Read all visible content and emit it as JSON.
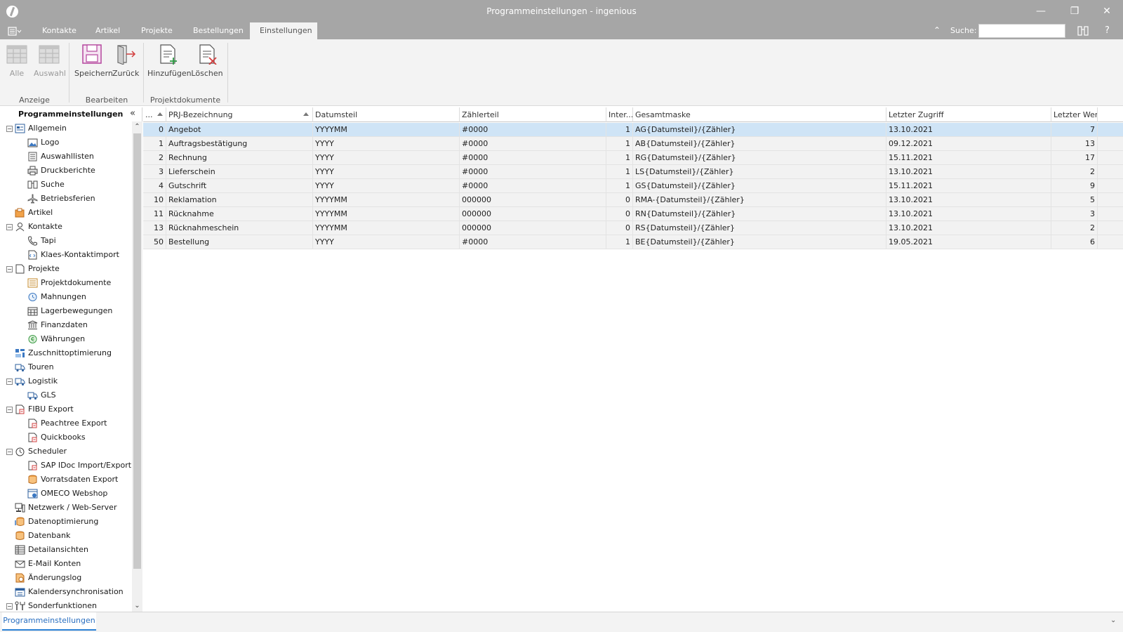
{
  "window": {
    "title": "Programmeinstellungen - ingenious",
    "minimize": "—",
    "maximize": "❐",
    "close": "✕"
  },
  "tabs": [
    {
      "label": "Kontakte"
    },
    {
      "label": "Artikel"
    },
    {
      "label": "Projekte"
    },
    {
      "label": "Bestellungen"
    },
    {
      "label": "Einstellungen",
      "active": true
    }
  ],
  "search": {
    "label": "Suche:",
    "value": "",
    "placeholder": ""
  },
  "help": "?",
  "ribbon": {
    "groups": [
      {
        "label": "Anzeige",
        "buttons": [
          {
            "label": "Alle"
          },
          {
            "label": "Auswahl"
          }
        ]
      },
      {
        "label": "Bearbeiten",
        "buttons": [
          {
            "label": "Speichern"
          },
          {
            "label": "Zurück"
          }
        ]
      },
      {
        "label": "Projektdokumente",
        "buttons": [
          {
            "label": "Hinzufügen"
          },
          {
            "label": "Löschen"
          }
        ]
      }
    ]
  },
  "sidebar": {
    "title": "Programmeinstellungen",
    "items": [
      {
        "label": "Allgemein",
        "level": 0,
        "expander": "−",
        "icon": "settings-window-icon"
      },
      {
        "label": "Logo",
        "level": 1,
        "icon": "image-icon"
      },
      {
        "label": "Auswahllisten",
        "level": 1,
        "icon": "list-icon"
      },
      {
        "label": "Druckberichte",
        "level": 1,
        "icon": "printer-icon"
      },
      {
        "label": "Suche",
        "level": 1,
        "icon": "binoculars-icon"
      },
      {
        "label": "Betriebsferien",
        "level": 1,
        "icon": "airplane-icon"
      },
      {
        "label": "Artikel",
        "level": 0,
        "icon": "box-icon"
      },
      {
        "label": "Kontakte",
        "level": 0,
        "expander": "−",
        "icon": "person-icon"
      },
      {
        "label": "Tapi",
        "level": 1,
        "icon": "phone-icon"
      },
      {
        "label": "Klaes-Kontaktimport",
        "level": 1,
        "icon": "xml-file-icon"
      },
      {
        "label": "Projekte",
        "level": 0,
        "expander": "−",
        "icon": "document-icon"
      },
      {
        "label": "Projektdokumente",
        "level": 1,
        "icon": "document-list-icon"
      },
      {
        "label": "Mahnungen",
        "level": 1,
        "icon": "reminder-icon"
      },
      {
        "label": "Lagerbewegungen",
        "level": 1,
        "icon": "warehouse-icon"
      },
      {
        "label": "Finanzdaten",
        "level": 1,
        "icon": "bank-icon"
      },
      {
        "label": "Währungen",
        "level": 1,
        "icon": "currency-icon"
      },
      {
        "label": "Zuschnittoptimierung",
        "level": 0,
        "icon": "cutting-icon"
      },
      {
        "label": "Touren",
        "level": 0,
        "icon": "truck-icon"
      },
      {
        "label": "Logistik",
        "level": 0,
        "expander": "−",
        "icon": "truck-icon"
      },
      {
        "label": "GLS",
        "level": 1,
        "icon": "truck-icon"
      },
      {
        "label": "FIBU Export",
        "level": 0,
        "expander": "−",
        "icon": "export-icon"
      },
      {
        "label": "Peachtree Export",
        "level": 1,
        "icon": "export-icon"
      },
      {
        "label": "Quickbooks",
        "level": 1,
        "icon": "export-icon"
      },
      {
        "label": "Scheduler",
        "level": 0,
        "expander": "−",
        "icon": "clock-icon"
      },
      {
        "label": "SAP IDoc Import/Export",
        "level": 1,
        "icon": "export-icon"
      },
      {
        "label": "Vorratsdaten Export",
        "level": 1,
        "icon": "database-export-icon"
      },
      {
        "label": "OMECO Webshop",
        "level": 1,
        "icon": "web-icon"
      },
      {
        "label": "Netzwerk / Web-Server",
        "level": 0,
        "icon": "network-icon"
      },
      {
        "label": "Datenoptimierung",
        "level": 0,
        "icon": "database-optimize-icon"
      },
      {
        "label": "Datenbank",
        "level": 0,
        "icon": "database-icon"
      },
      {
        "label": "Detailansichten",
        "level": 0,
        "icon": "table-icon"
      },
      {
        "label": "E-Mail Konten",
        "level": 0,
        "icon": "email-icon"
      },
      {
        "label": "Änderungslog",
        "level": 0,
        "icon": "log-icon"
      },
      {
        "label": "Kalendersynchronisation",
        "level": 0,
        "icon": "calendar-icon"
      },
      {
        "label": "Sonderfunktionen",
        "level": 0,
        "expander": "−",
        "icon": "tools-icon"
      }
    ]
  },
  "grid": {
    "columns": [
      {
        "label": "..."
      },
      {
        "label": "PRJ-Bezeichnung"
      },
      {
        "label": "Datumsteil"
      },
      {
        "label": "Zählerteil"
      },
      {
        "label": "Inter..."
      },
      {
        "label": "Gesamtmaske"
      },
      {
        "label": "Letzter Zugriff"
      },
      {
        "label": "Letzter Wert"
      }
    ],
    "rows": [
      [
        "0",
        "Angebot",
        "YYYYMM",
        "#0000",
        "1",
        "AG{Datumsteil}/{Zähler}",
        "13.10.2021",
        "7"
      ],
      [
        "1",
        "Auftragsbestätigung",
        "YYYY",
        "#0000",
        "1",
        "AB{Datumsteil}/{Zähler}",
        "09.12.2021",
        "13"
      ],
      [
        "2",
        "Rechnung",
        "YYYY",
        "#0000",
        "1",
        "RG{Datumsteil}/{Zähler}",
        "15.11.2021",
        "17"
      ],
      [
        "3",
        "Lieferschein",
        "YYYY",
        "#0000",
        "1",
        "LS{Datumsteil}/{Zähler}",
        "13.10.2021",
        "2"
      ],
      [
        "4",
        "Gutschrift",
        "YYYY",
        "#0000",
        "1",
        "GS{Datumsteil}/{Zähler}",
        "15.11.2021",
        "9"
      ],
      [
        "10",
        "Reklamation",
        "YYYYMM",
        "000000",
        "0",
        "RMA-{Datumsteil}/{Zähler}",
        "13.10.2021",
        "5"
      ],
      [
        "11",
        "Rücknahme",
        "YYYYMM",
        "000000",
        "0",
        "RN{Datumsteil}/{Zähler}",
        "13.10.2021",
        "3"
      ],
      [
        "13",
        "Rücknahmeschein",
        "YYYYMM",
        "000000",
        "0",
        "RS{Datumsteil}/{Zähler}",
        "13.10.2021",
        "2"
      ],
      [
        "50",
        "Bestellung",
        "YYYY",
        "#0000",
        "1",
        "BE{Datumsteil}/{Zähler}",
        "19.05.2021",
        "6"
      ]
    ],
    "selected_row": 0
  },
  "bottom": {
    "tab": "Programmeinstellungen"
  },
  "colors": {
    "chrome": "#a6a6a6",
    "ribbon": "#f3f3f3",
    "selected_row": "#cfe4f6",
    "accent": "#2a7fd4"
  }
}
